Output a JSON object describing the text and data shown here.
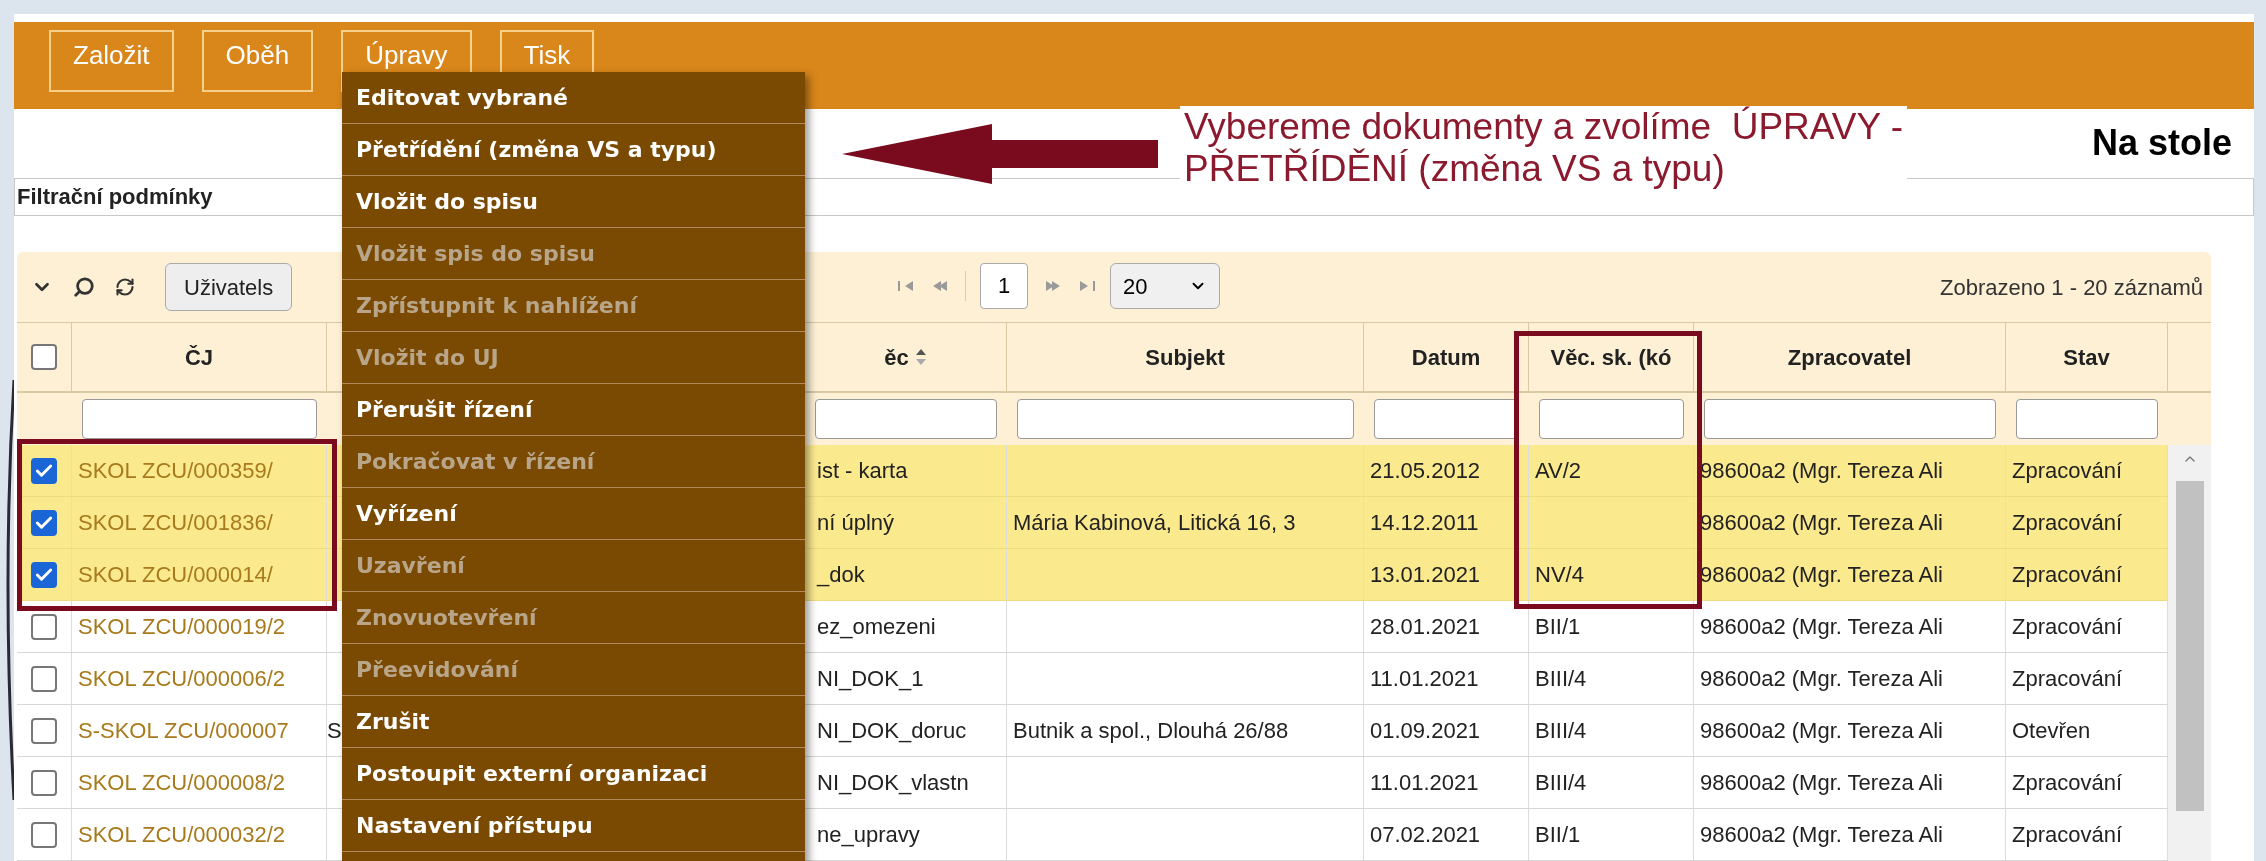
{
  "toolbar": {
    "buttons": [
      {
        "label": "Založit"
      },
      {
        "label": "Oběh"
      },
      {
        "label": "Úpravy"
      },
      {
        "label": "Tisk"
      }
    ]
  },
  "menu": {
    "items": [
      {
        "label": "Editovat vybrané",
        "disabled": false
      },
      {
        "label": "Přetřídění (změna VS a typu)",
        "disabled": false
      },
      {
        "label": "Vložit do spisu",
        "disabled": false
      },
      {
        "label": "Vložit spis do spisu",
        "disabled": true
      },
      {
        "label": "Zpřístupnit k nahlížení",
        "disabled": true
      },
      {
        "label": "Vložit do UJ",
        "disabled": true
      },
      {
        "label": "Přerušit řízení",
        "disabled": false
      },
      {
        "label": "Pokračovat v řízení",
        "disabled": true
      },
      {
        "label": "Vyřízení",
        "disabled": false
      },
      {
        "label": "Uzavření",
        "disabled": true
      },
      {
        "label": "Znovuotevření",
        "disabled": true
      },
      {
        "label": "Přeevidování",
        "disabled": true
      },
      {
        "label": "Zrušit",
        "disabled": false
      },
      {
        "label": "Postoupit externí organizaci",
        "disabled": false
      },
      {
        "label": "Nastavení přístupu",
        "disabled": false
      }
    ]
  },
  "annotation": {
    "lines": [
      "Vybereme dokumenty a zvolíme  ÚPRAVY -",
      "PŘETŘÍDĚNÍ (změna VS a typu)"
    ]
  },
  "page_title": "Na stole",
  "filter_bar": {
    "label": "Filtrační podmínky"
  },
  "grid_toolbar": {
    "user_button": "Uživatels",
    "page": "1",
    "page_size": "20",
    "summary": "Zobrazeno 1 - 20 záznamů"
  },
  "table": {
    "select_all_checked": false,
    "columns": [
      {
        "label": "ČJ"
      },
      {},
      {
        "label": "ěc",
        "sortable": true
      },
      {
        "label": "Subjekt"
      },
      {
        "label": "Datum"
      },
      {
        "label": "Věc. sk. (kó"
      },
      {
        "label": "Zpracovatel"
      },
      {
        "label": "Stav"
      }
    ],
    "rows": [
      {
        "selected": true,
        "cells": [
          "SKOL ZCU/000359/",
          "",
          "ist - karta",
          "",
          "21.05.2012",
          "AV/2",
          "98600a2 (Mgr. Tereza Ali",
          "Zpracování"
        ]
      },
      {
        "selected": true,
        "cells": [
          "SKOL ZCU/001836/",
          "",
          "ní úplný",
          "Mária Kabinová, Litická 16, 3",
          "14.12.2011",
          "",
          "98600a2 (Mgr. Tereza Ali",
          "Zpracování"
        ]
      },
      {
        "selected": true,
        "cells": [
          "SKOL ZCU/000014/",
          "",
          "_dok",
          "",
          "13.01.2021",
          "NV/4",
          "98600a2 (Mgr. Tereza Ali",
          "Zpracování"
        ]
      },
      {
        "selected": false,
        "cells": [
          "SKOL ZCU/000019/2",
          "",
          "ez_omezeni",
          "",
          "28.01.2021",
          "BII/1",
          "98600a2 (Mgr. Tereza Ali",
          "Zpracování"
        ]
      },
      {
        "selected": false,
        "cells": [
          "SKOL ZCU/000006/2",
          "",
          "NI_DOK_1",
          "",
          "11.01.2021",
          "BIII/4",
          "98600a2 (Mgr. Tereza Ali",
          "Zpracování"
        ]
      },
      {
        "selected": false,
        "cells": [
          "S-SKOL ZCU/000007",
          "S",
          "NI_DOK_doruc",
          "Butnik a spol., Dlouhá 26/88",
          "01.09.2021",
          "BIII/4",
          "98600a2 (Mgr. Tereza Ali",
          "Otevřen"
        ]
      },
      {
        "selected": false,
        "cells": [
          "SKOL ZCU/000008/2",
          "",
          "NI_DOK_vlastn",
          "",
          "11.01.2021",
          "BIII/4",
          "98600a2 (Mgr. Tereza Ali",
          "Zpracování"
        ]
      },
      {
        "selected": false,
        "cells": [
          "SKOL ZCU/000032/2",
          "",
          "ne_upravy",
          "",
          "07.02.2021",
          "BII/1",
          "98600a2 (Mgr. Tereza Ali",
          "Zpracování"
        ]
      }
    ]
  }
}
